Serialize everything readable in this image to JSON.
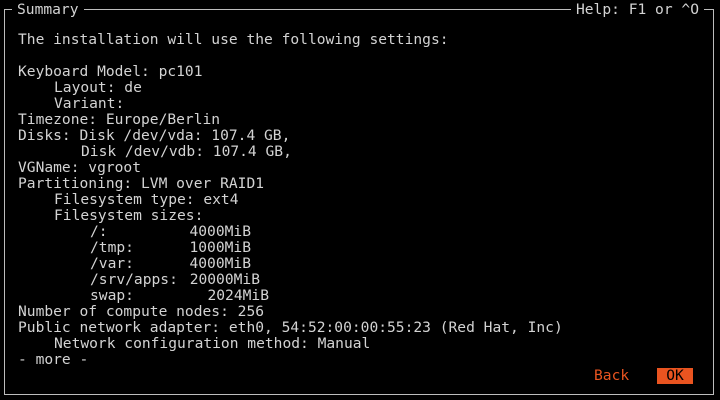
{
  "header": {
    "title": "Summary",
    "help": "Help: F1 or ^O"
  },
  "summary": {
    "intro": "The installation will use the following settings:",
    "keyboard_model": "Keyboard Model: pc101",
    "layout": "Layout: de",
    "variant": "Variant:",
    "timezone": "Timezone: Europe/Berlin",
    "disks_1": "Disks: Disk /dev/vda: 107.4 GB,",
    "disks_2": "Disk /dev/vdb: 107.4 GB,",
    "vgname": "VGName: vgroot",
    "partitioning": "Partitioning: LVM over RAID1",
    "fs_type": "Filesystem type: ext4",
    "fs_sizes_label": "Filesystem sizes:",
    "fs_sizes": [
      {
        "path": "/:",
        "size": "4000MiB"
      },
      {
        "path": "/tmp:",
        "size": "1000MiB"
      },
      {
        "path": "/var:",
        "size": "4000MiB"
      },
      {
        "path": "/srv/apps:",
        "size": "20000MiB"
      },
      {
        "path": "swap:",
        "size": "2024MiB"
      }
    ],
    "compute_nodes": "Number of compute nodes: 256",
    "network_adapter": "Public network adapter: eth0, 54:52:00:00:55:23 (Red Hat, Inc)",
    "net_method": "Network configuration method: Manual",
    "more": "- more -"
  },
  "buttons": {
    "back": "Back",
    "ok": "OK"
  },
  "colors": {
    "accent": "#e95420",
    "background": "#000000",
    "text": "#d3d3d3"
  }
}
